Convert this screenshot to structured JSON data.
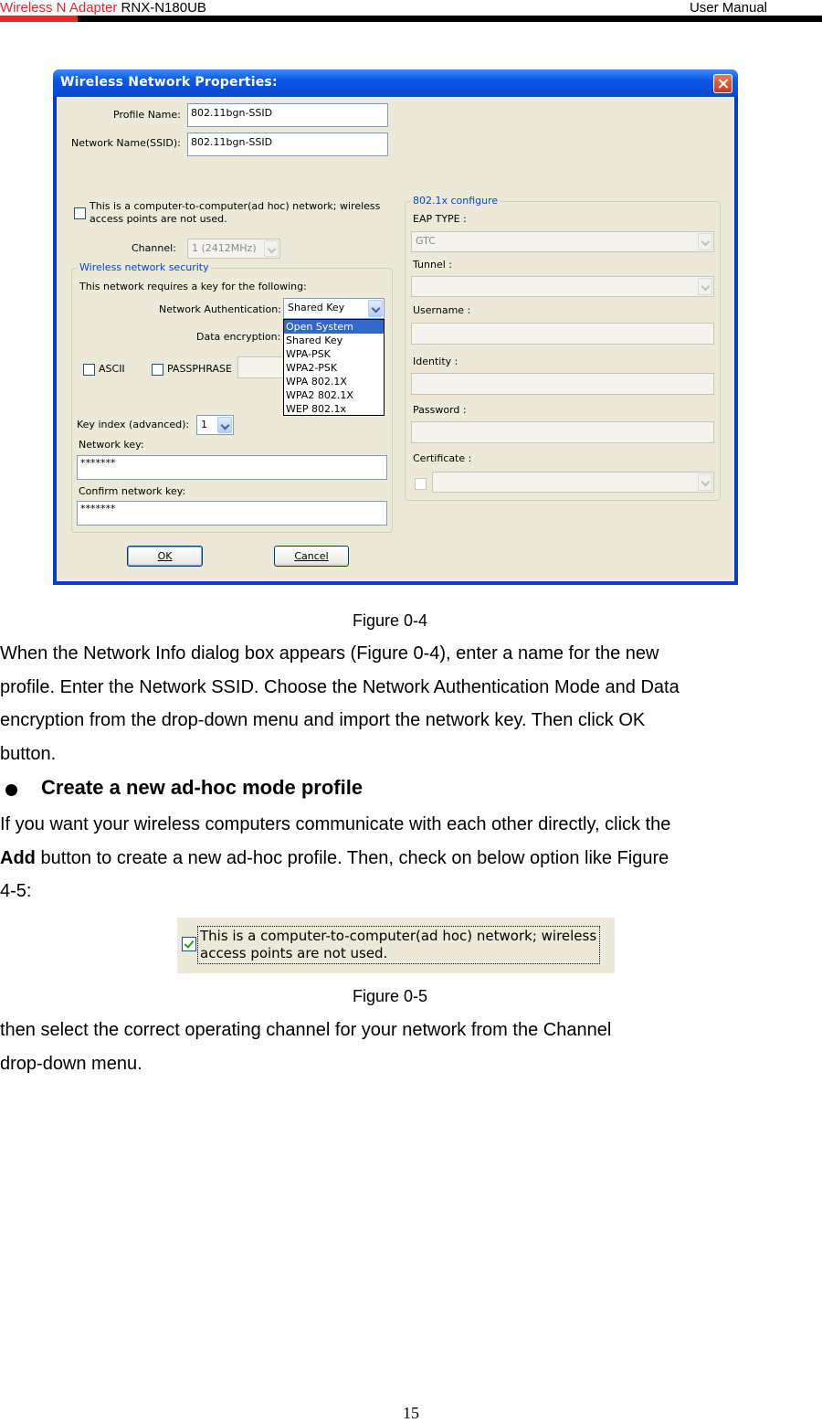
{
  "header": {
    "brand": "Wireless N Adapter",
    "model": " RNX-N180UB",
    "doc": "User Manual"
  },
  "dialog": {
    "title": "Wireless Network Properties:",
    "profile_name_label": "Profile Name:",
    "profile_name_value": "802.11bgn-SSID",
    "ssid_label": "Network Name(SSID):",
    "ssid_value": "802.11bgn-SSID",
    "adhoc_label_line1": "This is a computer-to-computer(ad hoc) network; wireless",
    "adhoc_label_line2": "access points are not used.",
    "channel_label": "Channel:",
    "channel_value": "1  (2412MHz)",
    "security": {
      "group_title": "Wireless network security",
      "requires_key": "This network requires a key for the following:",
      "auth_label": "Network Authentication:",
      "auth_value": "Shared Key",
      "encryption_label": "Data encryption:",
      "auth_options": [
        "Open System",
        "Shared Key",
        "WPA-PSK",
        "WPA2-PSK",
        "WPA 802.1X",
        "WPA2 802.1X",
        "WEP 802.1x"
      ],
      "ascii_label": "ASCII",
      "passphrase_label": "PASSPHRASE",
      "key_index_label": "Key index (advanced):",
      "key_index_value": "1",
      "network_key_label": "Network key:",
      "network_key_value": "*******",
      "confirm_key_label": "Confirm network key:",
      "confirm_key_value": "*******"
    },
    "x8021": {
      "group_title": "802.1x configure",
      "eap_label": "EAP TYPE :",
      "eap_value": "GTC",
      "tunnel_label": "Tunnel :",
      "username_label": "Username :",
      "identity_label": "Identity :",
      "password_label": "Password :",
      "certificate_label": "Certificate :"
    },
    "ok_label": "OK",
    "cancel_label": "Cancel"
  },
  "figure4_caption": "Figure 0-4",
  "para1": [
    "When the Network Info dialog box appears (Figure 0-4), enter a name for the new",
    "profile. Enter the Network SSID. Choose the Network Authentication Mode and Data",
    "encryption from the drop-down menu and import the network key. Then click OK",
    "button."
  ],
  "bullet_heading": "Create a new ad-hoc mode profile",
  "para2": {
    "line1": "If you want your wireless computers communicate with each other directly, click the",
    "line2_bold": "Add",
    "line2_rest": " button to create a new ad-hoc profile. Then, check on below option like Figure",
    "line3": "4-5:"
  },
  "figure5": {
    "line1": "This is a computer-to-computer(ad hoc) network; wireless",
    "line2": "access points are not used."
  },
  "figure5_caption": "Figure 0-5",
  "para3": [
    "then select the correct operating channel for your network from the Channel",
    "drop-down menu."
  ],
  "page_number": "15"
}
